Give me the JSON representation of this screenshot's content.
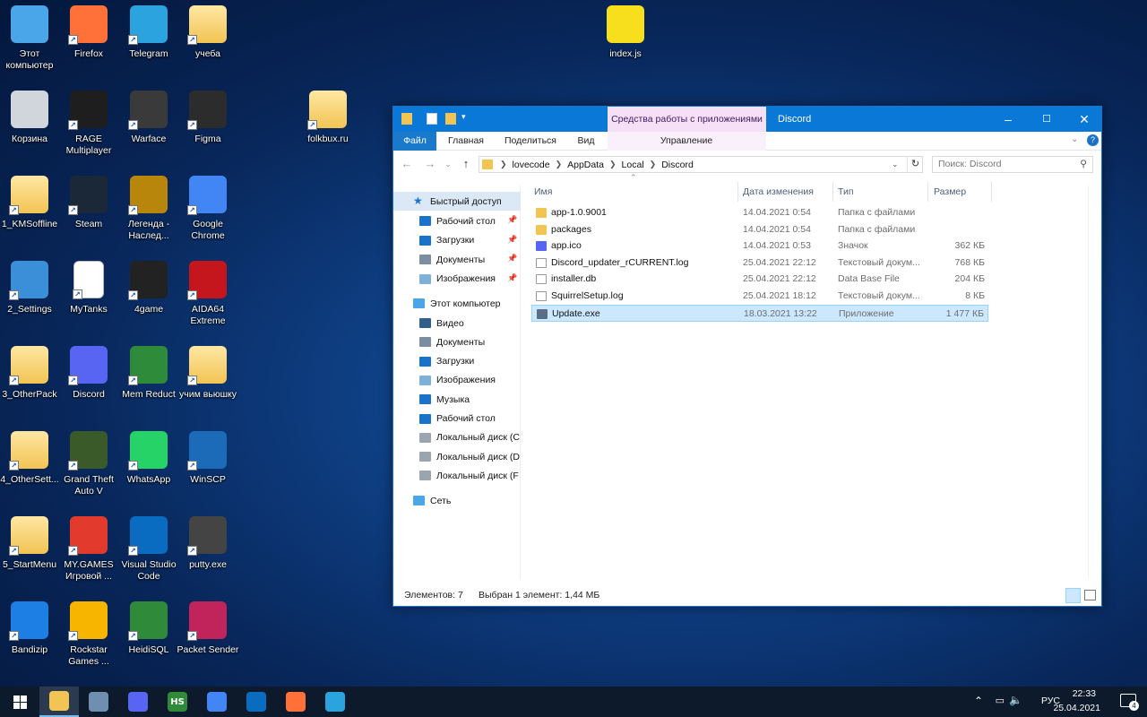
{
  "desktop": {
    "icons": [
      {
        "label": "Этот компьютер",
        "icon": "this-pc-icon",
        "color": "#4aa6e8"
      },
      {
        "label": "Firefox",
        "icon": "firefox-icon",
        "color": "#ff7139"
      },
      {
        "label": "Telegram",
        "icon": "telegram-icon",
        "color": "#2aa3df"
      },
      {
        "label": "учеба",
        "icon": "folder-icon",
        "color": "#f2c453"
      },
      {
        "label": "index.js",
        "icon": "js-file-icon",
        "color": "#f7df1e"
      },
      {
        "label": "Корзина",
        "icon": "recycle-bin-icon",
        "color": "#d0d6dc"
      },
      {
        "label": "RAGE Multiplayer",
        "icon": "rage-mp-icon",
        "color": "#1e1e1e"
      },
      {
        "label": "Warface",
        "icon": "warface-icon",
        "color": "#3a3a3a"
      },
      {
        "label": "Figma",
        "icon": "figma-icon",
        "color": "#2c2c2c"
      },
      {
        "label": "folkbux.ru",
        "icon": "folder-icon",
        "color": "#f2c453"
      },
      {
        "label": "1_KMSoffline",
        "icon": "folder-icon",
        "color": "#f2c453"
      },
      {
        "label": "Steam",
        "icon": "steam-icon",
        "color": "#1b2838"
      },
      {
        "label": "Легенда - Наслед...",
        "icon": "legend-game-icon",
        "color": "#b8860b"
      },
      {
        "label": "Google Chrome",
        "icon": "chrome-icon",
        "color": "#4285f4"
      },
      {
        "label": "2_Settings",
        "icon": "settings-shortcut-icon",
        "color": "#3a8fd8"
      },
      {
        "label": "MyTanks",
        "icon": "file-icon",
        "color": "#ffffff"
      },
      {
        "label": "4game",
        "icon": "4game-icon",
        "color": "#222222"
      },
      {
        "label": "AIDA64 Extreme",
        "icon": "aida64-icon",
        "color": "#c4161c"
      },
      {
        "label": "3_OtherPack",
        "icon": "folder-icon",
        "color": "#f2c453"
      },
      {
        "label": "Discord",
        "icon": "discord-icon",
        "color": "#5865f2"
      },
      {
        "label": "Mem Reduct",
        "icon": "mem-reduct-icon",
        "color": "#2e8b3a"
      },
      {
        "label": "учим вьюшку",
        "icon": "folder-icon",
        "color": "#f2c453"
      },
      {
        "label": "4_OtherSett...",
        "icon": "folder-icon",
        "color": "#f2c453"
      },
      {
        "label": "Grand Theft Auto V",
        "icon": "gta5-icon",
        "color": "#3a5a2a"
      },
      {
        "label": "WhatsApp",
        "icon": "whatsapp-icon",
        "color": "#25d366"
      },
      {
        "label": "WinSCP",
        "icon": "winscp-icon",
        "color": "#1b6bb8"
      },
      {
        "label": "5_StartMenu",
        "icon": "folder-icon",
        "color": "#f2c453"
      },
      {
        "label": "MY.GAMES Игровой ...",
        "icon": "mygames-icon",
        "color": "#e23b2e"
      },
      {
        "label": "Visual Studio Code",
        "icon": "vscode-icon",
        "color": "#0a6cc0"
      },
      {
        "label": "putty.exe",
        "icon": "putty-icon",
        "color": "#444444"
      },
      {
        "label": "Bandizip",
        "icon": "bandizip-icon",
        "color": "#1d7fe3"
      },
      {
        "label": "Rockstar Games ...",
        "icon": "rockstar-icon",
        "color": "#f7b500"
      },
      {
        "label": "HeidiSQL",
        "icon": "heidisql-icon",
        "color": "#2f8a3a"
      },
      {
        "label": "Packet Sender",
        "icon": "packet-sender-icon",
        "color": "#c0245a"
      }
    ]
  },
  "window": {
    "title": "Discord",
    "context_tab": "Средства работы с приложениями",
    "ribbon_tabs": [
      "Файл",
      "Главная",
      "Поделиться",
      "Вид",
      "Управление"
    ],
    "address": [
      "lovecode",
      "AppData",
      "Local",
      "Discord"
    ],
    "search_placeholder": "Поиск: Discord",
    "nav": {
      "quick_access": "Быстрый доступ",
      "quick_items": [
        "Рабочий стол",
        "Загрузки",
        "Документы",
        "Изображения"
      ],
      "this_pc": "Этот компьютер",
      "pc_items": [
        "Видео",
        "Документы",
        "Загрузки",
        "Изображения",
        "Музыка",
        "Рабочий стол",
        "Локальный диск (C",
        "Локальный диск (D",
        "Локальный диск (F"
      ],
      "network": "Сеть"
    },
    "columns": [
      "Имя",
      "Дата изменения",
      "Тип",
      "Размер"
    ],
    "files": [
      {
        "name": "app-1.0.9001",
        "date": "14.04.2021 0:54",
        "type": "Папка с файлами",
        "size": "",
        "icon": "folder-icon"
      },
      {
        "name": "packages",
        "date": "14.04.2021 0:54",
        "type": "Папка с файлами",
        "size": "",
        "icon": "folder-icon"
      },
      {
        "name": "app.ico",
        "date": "14.04.2021 0:53",
        "type": "Значок",
        "size": "362 КБ",
        "icon": "discord-icon"
      },
      {
        "name": "Discord_updater_rCURRENT.log",
        "date": "25.04.2021 22:12",
        "type": "Текстовый докум...",
        "size": "768 КБ",
        "icon": "text-file-icon"
      },
      {
        "name": "installer.db",
        "date": "25.04.2021 22:12",
        "type": "Data Base File",
        "size": "204 КБ",
        "icon": "file-icon"
      },
      {
        "name": "SquirrelSetup.log",
        "date": "25.04.2021 18:12",
        "type": "Текстовый докум...",
        "size": "8 КБ",
        "icon": "text-file-icon"
      },
      {
        "name": "Update.exe",
        "date": "18.03.2021 13:22",
        "type": "Приложение",
        "size": "1 477 КБ",
        "icon": "exe-icon"
      }
    ],
    "selected_index": 6,
    "status": {
      "count": "Элементов: 7",
      "selection": "Выбран 1 элемент: 1,44 МБ"
    }
  },
  "taskbar": {
    "apps": [
      {
        "name": "explorer-icon",
        "color": "#f2c453",
        "text": ""
      },
      {
        "name": "this-pc-icon",
        "color": "#6f8fb0",
        "text": ""
      },
      {
        "name": "discord-icon",
        "color": "#5865f2",
        "text": ""
      },
      {
        "name": "heidisql-icon",
        "color": "#2f8a3a",
        "text": "HS"
      },
      {
        "name": "chrome-icon",
        "color": "#4285f4",
        "text": ""
      },
      {
        "name": "vscode-icon",
        "color": "#0a6cc0",
        "text": ""
      },
      {
        "name": "firefox-icon",
        "color": "#ff7139",
        "text": ""
      },
      {
        "name": "telegram-icon",
        "color": "#2aa3df",
        "text": ""
      }
    ],
    "lang": "РУС",
    "time": "22:33",
    "date": "25.04.2021",
    "notification_count": "4"
  }
}
